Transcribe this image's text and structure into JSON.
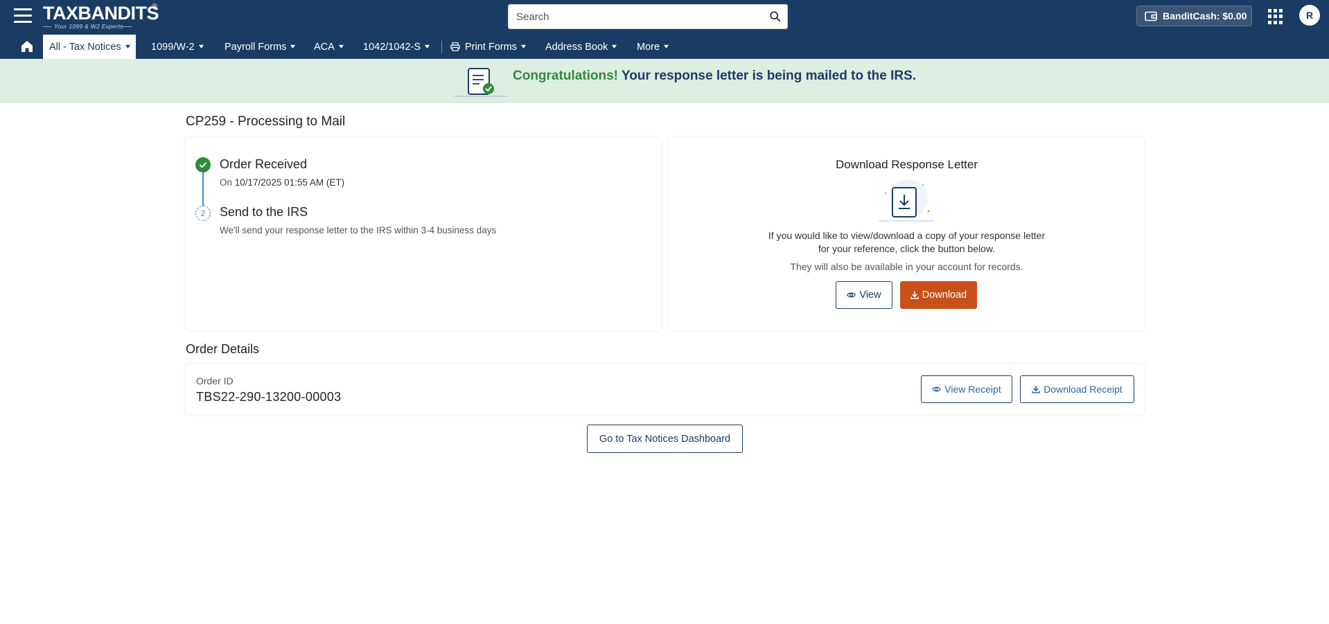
{
  "header": {
    "logo": {
      "text": "TAXBANDITS",
      "reg": "®",
      "tagline": "Your 1099 & W2 Experts"
    },
    "search": {
      "placeholder": "Search"
    },
    "bandit_cash": "BanditCash: $0.00",
    "avatar_initial": "R"
  },
  "nav": {
    "items": [
      {
        "label": "All - Tax Notices",
        "active": true
      },
      {
        "label": "1099/W-2"
      },
      {
        "label": "Payroll Forms"
      },
      {
        "label": "ACA"
      },
      {
        "label": "1042/1042-S"
      },
      {
        "label": "Print Forms",
        "icon": "printer-icon"
      },
      {
        "label": "Address Book"
      },
      {
        "label": "More"
      }
    ],
    "chevron": "▾"
  },
  "banner": {
    "highlight": "Congratulations!",
    "message": " Your response letter is being mailed to the IRS."
  },
  "page": {
    "title": "CP259 - Processing to Mail"
  },
  "steps": [
    {
      "title": "Order Received",
      "sub_prefix": "On ",
      "sub_value": "10/17/2025 01:55 AM (ET)",
      "status": "complete",
      "icon": "check-icon"
    },
    {
      "number": "2",
      "title": "Send to the IRS",
      "sub": "We'll send your response letter to the IRS within 3-4 business days",
      "status": "pending"
    }
  ],
  "download_letter": {
    "title": "Download Response Letter",
    "text_line1": "If you would like to view/download a copy of your response letter",
    "text_line2": "for your reference, click the button below.",
    "sub": "They will also be available in your account for records.",
    "view_label": "View",
    "download_label": "Download"
  },
  "order_details": {
    "section_title": "Order Details",
    "order_id_label": "Order ID",
    "order_id": "TBS22-290-13200-00003",
    "view_receipt_label": "View Receipt",
    "download_receipt_label": "Download Receipt"
  },
  "dashboard_button": "Go to Tax Notices Dashboard",
  "colors": {
    "navy": "#1b3c62",
    "success_green": "#2f8a3b",
    "banner_bg": "#dfeee3",
    "download_orange": "#c8501a",
    "link_blue": "#2b63a6"
  }
}
